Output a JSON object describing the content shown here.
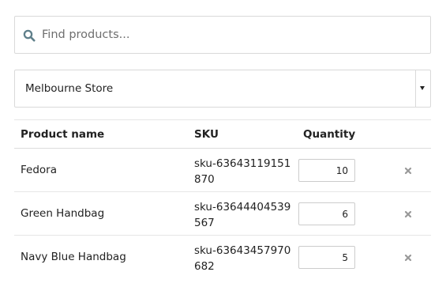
{
  "search": {
    "placeholder": "Find products...",
    "value": "",
    "icon": "search-icon"
  },
  "store": {
    "selected": "Melbourne Store",
    "icon": "caret-down-icon"
  },
  "table": {
    "headers": {
      "product": "Product name",
      "sku": "SKU",
      "quantity": "Quantity"
    },
    "rows": [
      {
        "name": "Fedora",
        "sku": "sku-63643119151870",
        "quantity": "10",
        "remove_icon": "close-icon"
      },
      {
        "name": "Green Handbag",
        "sku": "sku-63644404539567",
        "quantity": "6",
        "remove_icon": "close-icon"
      },
      {
        "name": "Navy Blue Handbag",
        "sku": "sku-63643457970682",
        "quantity": "5",
        "remove_icon": "close-icon"
      }
    ]
  },
  "colors": {
    "search_icon": "#5f7f8a",
    "border": "#d9d9d9",
    "remove_icon": "#999999",
    "text": "#222222"
  }
}
